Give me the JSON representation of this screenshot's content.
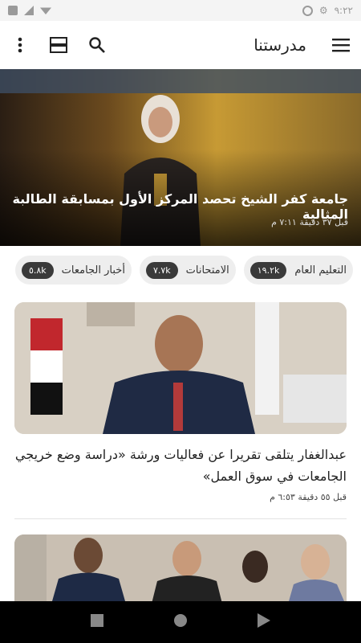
{
  "status_bar": {
    "time": "٩:٢٢",
    "icons": [
      "gear-icon",
      "data-saver-icon",
      "wifi-icon",
      "signal-icon",
      "battery-icon"
    ]
  },
  "app_bar": {
    "title": "مدرستنا",
    "icons": [
      "menu-icon",
      "search-icon",
      "layout-icon",
      "more-vert-icon"
    ]
  },
  "hero": {
    "title": "جامعة كفر الشيخ تحصد المركز الأول بمسابقة الطالبة المثالية",
    "time": "قبل ٣٧ دقيقة ٧:١١ م"
  },
  "chips": [
    {
      "label": "التعليم العام",
      "count": "١٩.٢k"
    },
    {
      "label": "الامتحانات",
      "count": "٧.٧k"
    },
    {
      "label": "أخبار الجامعات",
      "count": "٥.٨k"
    }
  ],
  "articles": [
    {
      "title": "عبدالغفار يتلقى تقريرا عن فعاليات ورشة «دراسة وضع خريجي الجامعات في سوق العمل»",
      "time": "قبل ٥٥ دقيقة ٦:٥٣ م"
    }
  ],
  "nav_bar": {
    "icons": [
      "recents-icon",
      "home-icon",
      "back-icon"
    ]
  },
  "colors": {
    "accent": "#3a3a3a",
    "chip_bg": "#eeeeee",
    "hero_overlay": "#000000"
  }
}
